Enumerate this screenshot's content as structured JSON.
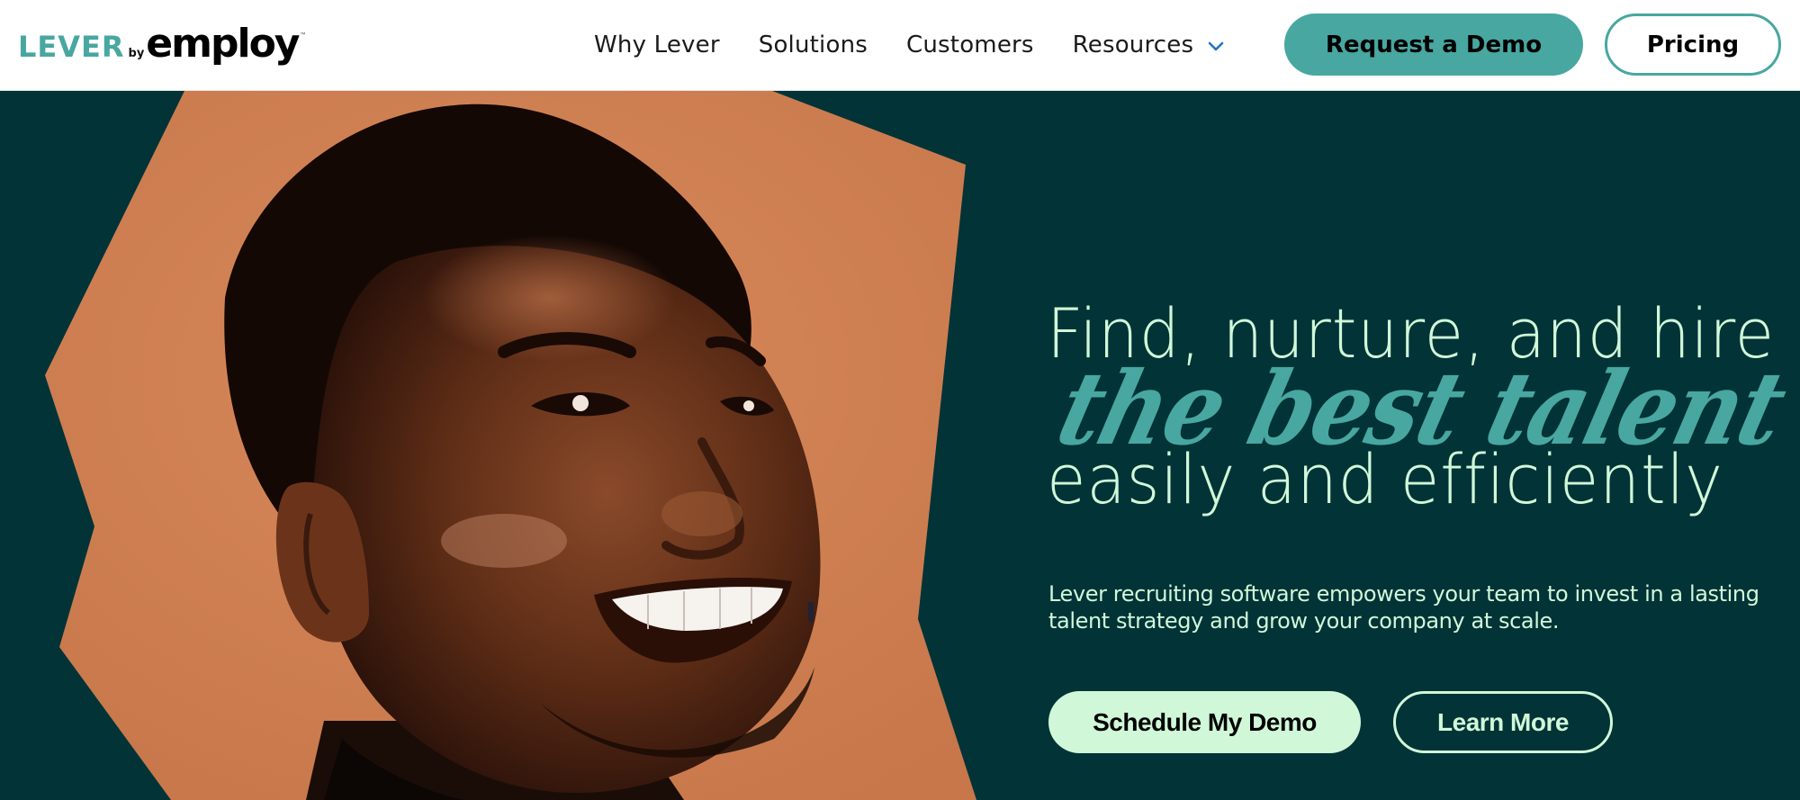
{
  "header": {
    "logo": {
      "primary": "LEVER",
      "connector": "by",
      "secondary": "employ",
      "trademark": "™"
    },
    "nav": [
      {
        "label": "Why Lever"
      },
      {
        "label": "Solutions"
      },
      {
        "label": "Customers"
      },
      {
        "label": "Resources",
        "has_dropdown": true,
        "icon": "chevron-down-icon"
      }
    ],
    "cta_primary": "Request a Demo",
    "cta_secondary": "Pricing"
  },
  "hero": {
    "headline_line1": "Find, nurture, and hire",
    "headline_script": "the best talent",
    "headline_line3": "easily and efficiently",
    "subtext": "Lever recruiting software empowers your team to invest in a lasting talent strategy and grow your company at scale.",
    "cta_primary": "Schedule My Demo",
    "cta_secondary": "Learn More",
    "image": "smiling-man-portrait"
  },
  "colors": {
    "brand_teal": "#48a7a0",
    "hero_background": "#013337",
    "mint": "#d0f8d8",
    "photo_backdrop": "#cf8255",
    "chevron_blue": "#1f73c4"
  }
}
